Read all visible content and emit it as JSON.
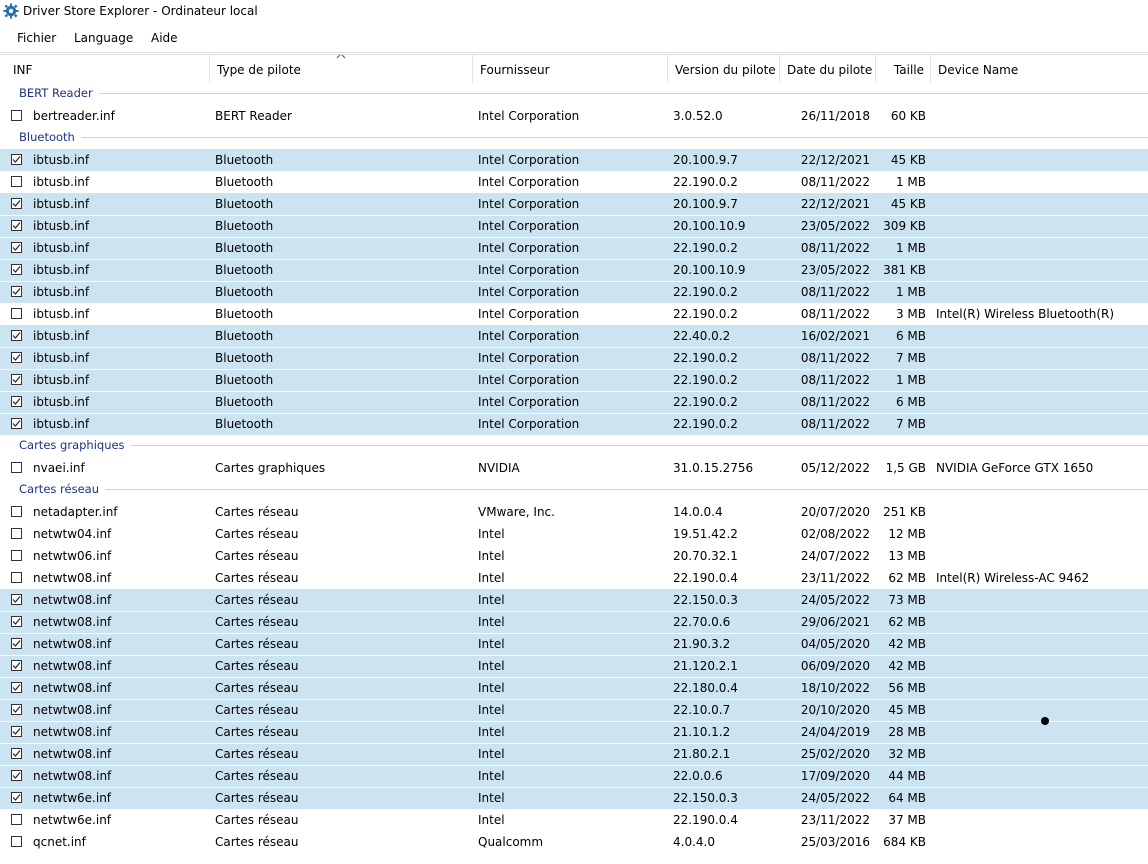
{
  "window": {
    "title": "Driver Store Explorer - Ordinateur local"
  },
  "menu": [
    "Fichier",
    "Language",
    "Aide"
  ],
  "columns": [
    "INF",
    "Type de pilote",
    "Fournisseur",
    "Version du pilote",
    "Date du pilote",
    "Taille",
    "Device Name"
  ],
  "groups": [
    {
      "label": "BERT Reader",
      "rows": [
        {
          "checked": false,
          "inf": "bertreader.inf",
          "type": "BERT Reader",
          "vendor": "Intel Corporation",
          "version": "3.0.52.0",
          "date": "26/11/2018",
          "size": "60 KB",
          "device": ""
        }
      ]
    },
    {
      "label": "Bluetooth",
      "rows": [
        {
          "checked": true,
          "inf": "ibtusb.inf",
          "type": "Bluetooth",
          "vendor": "Intel Corporation",
          "version": "20.100.9.7",
          "date": "22/12/2021",
          "size": "45 KB",
          "device": ""
        },
        {
          "checked": false,
          "inf": "ibtusb.inf",
          "type": "Bluetooth",
          "vendor": "Intel Corporation",
          "version": "22.190.0.2",
          "date": "08/11/2022",
          "size": "1 MB",
          "device": ""
        },
        {
          "checked": true,
          "inf": "ibtusb.inf",
          "type": "Bluetooth",
          "vendor": "Intel Corporation",
          "version": "20.100.9.7",
          "date": "22/12/2021",
          "size": "45 KB",
          "device": ""
        },
        {
          "checked": true,
          "inf": "ibtusb.inf",
          "type": "Bluetooth",
          "vendor": "Intel Corporation",
          "version": "20.100.10.9",
          "date": "23/05/2022",
          "size": "309 KB",
          "device": ""
        },
        {
          "checked": true,
          "inf": "ibtusb.inf",
          "type": "Bluetooth",
          "vendor": "Intel Corporation",
          "version": "22.190.0.2",
          "date": "08/11/2022",
          "size": "1 MB",
          "device": ""
        },
        {
          "checked": true,
          "inf": "ibtusb.inf",
          "type": "Bluetooth",
          "vendor": "Intel Corporation",
          "version": "20.100.10.9",
          "date": "23/05/2022",
          "size": "381 KB",
          "device": ""
        },
        {
          "checked": true,
          "inf": "ibtusb.inf",
          "type": "Bluetooth",
          "vendor": "Intel Corporation",
          "version": "22.190.0.2",
          "date": "08/11/2022",
          "size": "1 MB",
          "device": ""
        },
        {
          "checked": false,
          "inf": "ibtusb.inf",
          "type": "Bluetooth",
          "vendor": "Intel Corporation",
          "version": "22.190.0.2",
          "date": "08/11/2022",
          "size": "3 MB",
          "device": "Intel(R) Wireless Bluetooth(R)"
        },
        {
          "checked": true,
          "inf": "ibtusb.inf",
          "type": "Bluetooth",
          "vendor": "Intel Corporation",
          "version": "22.40.0.2",
          "date": "16/02/2021",
          "size": "6 MB",
          "device": ""
        },
        {
          "checked": true,
          "inf": "ibtusb.inf",
          "type": "Bluetooth",
          "vendor": "Intel Corporation",
          "version": "22.190.0.2",
          "date": "08/11/2022",
          "size": "7 MB",
          "device": ""
        },
        {
          "checked": true,
          "inf": "ibtusb.inf",
          "type": "Bluetooth",
          "vendor": "Intel Corporation",
          "version": "22.190.0.2",
          "date": "08/11/2022",
          "size": "1 MB",
          "device": ""
        },
        {
          "checked": true,
          "inf": "ibtusb.inf",
          "type": "Bluetooth",
          "vendor": "Intel Corporation",
          "version": "22.190.0.2",
          "date": "08/11/2022",
          "size": "6 MB",
          "device": ""
        },
        {
          "checked": true,
          "inf": "ibtusb.inf",
          "type": "Bluetooth",
          "vendor": "Intel Corporation",
          "version": "22.190.0.2",
          "date": "08/11/2022",
          "size": "7 MB",
          "device": ""
        }
      ]
    },
    {
      "label": "Cartes graphiques",
      "rows": [
        {
          "checked": false,
          "inf": "nvaei.inf",
          "type": "Cartes graphiques",
          "vendor": "NVIDIA",
          "version": "31.0.15.2756",
          "date": "05/12/2022",
          "size": "1,5 GB",
          "device": "NVIDIA GeForce GTX 1650"
        }
      ]
    },
    {
      "label": "Cartes réseau",
      "rows": [
        {
          "checked": false,
          "inf": "netadapter.inf",
          "type": "Cartes réseau",
          "vendor": "VMware, Inc.",
          "version": "14.0.0.4",
          "date": "20/07/2020",
          "size": "251 KB",
          "device": ""
        },
        {
          "checked": false,
          "inf": "netwtw04.inf",
          "type": "Cartes réseau",
          "vendor": "Intel",
          "version": "19.51.42.2",
          "date": "02/08/2022",
          "size": "12 MB",
          "device": ""
        },
        {
          "checked": false,
          "inf": "netwtw06.inf",
          "type": "Cartes réseau",
          "vendor": "Intel",
          "version": "20.70.32.1",
          "date": "24/07/2022",
          "size": "13 MB",
          "device": ""
        },
        {
          "checked": false,
          "inf": "netwtw08.inf",
          "type": "Cartes réseau",
          "vendor": "Intel",
          "version": "22.190.0.4",
          "date": "23/11/2022",
          "size": "62 MB",
          "device": "Intel(R) Wireless-AC 9462"
        },
        {
          "checked": true,
          "inf": "netwtw08.inf",
          "type": "Cartes réseau",
          "vendor": "Intel",
          "version": "22.150.0.3",
          "date": "24/05/2022",
          "size": "73 MB",
          "device": ""
        },
        {
          "checked": true,
          "inf": "netwtw08.inf",
          "type": "Cartes réseau",
          "vendor": "Intel",
          "version": "22.70.0.6",
          "date": "29/06/2021",
          "size": "62 MB",
          "device": ""
        },
        {
          "checked": true,
          "inf": "netwtw08.inf",
          "type": "Cartes réseau",
          "vendor": "Intel",
          "version": "21.90.3.2",
          "date": "04/05/2020",
          "size": "42 MB",
          "device": ""
        },
        {
          "checked": true,
          "inf": "netwtw08.inf",
          "type": "Cartes réseau",
          "vendor": "Intel",
          "version": "21.120.2.1",
          "date": "06/09/2020",
          "size": "42 MB",
          "device": ""
        },
        {
          "checked": true,
          "inf": "netwtw08.inf",
          "type": "Cartes réseau",
          "vendor": "Intel",
          "version": "22.180.0.4",
          "date": "18/10/2022",
          "size": "56 MB",
          "device": ""
        },
        {
          "checked": true,
          "inf": "netwtw08.inf",
          "type": "Cartes réseau",
          "vendor": "Intel",
          "version": "22.10.0.7",
          "date": "20/10/2020",
          "size": "45 MB",
          "device": ""
        },
        {
          "checked": true,
          "inf": "netwtw08.inf",
          "type": "Cartes réseau",
          "vendor": "Intel",
          "version": "21.10.1.2",
          "date": "24/04/2019",
          "size": "28 MB",
          "device": ""
        },
        {
          "checked": true,
          "inf": "netwtw08.inf",
          "type": "Cartes réseau",
          "vendor": "Intel",
          "version": "21.80.2.1",
          "date": "25/02/2020",
          "size": "32 MB",
          "device": ""
        },
        {
          "checked": true,
          "inf": "netwtw08.inf",
          "type": "Cartes réseau",
          "vendor": "Intel",
          "version": "22.0.0.6",
          "date": "17/09/2020",
          "size": "44 MB",
          "device": ""
        },
        {
          "checked": true,
          "inf": "netwtw6e.inf",
          "type": "Cartes réseau",
          "vendor": "Intel",
          "version": "22.150.0.3",
          "date": "24/05/2022",
          "size": "64 MB",
          "device": ""
        },
        {
          "checked": false,
          "inf": "netwtw6e.inf",
          "type": "Cartes réseau",
          "vendor": "Intel",
          "version": "22.190.0.4",
          "date": "23/11/2022",
          "size": "37 MB",
          "device": ""
        },
        {
          "checked": false,
          "inf": "qcnet.inf",
          "type": "Cartes réseau",
          "vendor": "Qualcomm",
          "version": "4.0.4.0",
          "date": "25/03/2016",
          "size": "684 KB",
          "device": ""
        }
      ]
    }
  ],
  "colors": {
    "selected_row": "#cce4f1",
    "group_label": "#1e3287",
    "group_line": "#c6d6e8"
  },
  "icons": {
    "app": "gear-icon",
    "sort": "sort-ascending-icon",
    "check": "checkmark-icon"
  }
}
